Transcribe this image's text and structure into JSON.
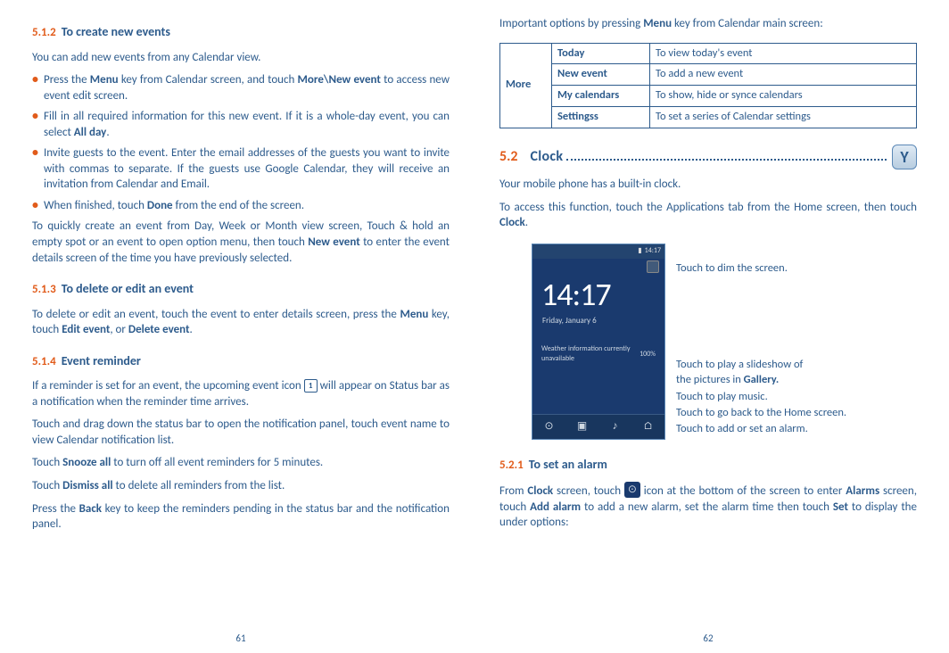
{
  "left": {
    "s512_num": "5.1.2",
    "s512_title": "To create new events",
    "s512_intro": "You can add new events from any Calendar view.",
    "b1_a": "Press the ",
    "b1_b": "Menu",
    "b1_c": " key from Calendar screen, and touch ",
    "b1_d": "More\\New event",
    "b1_e": " to access new event edit screen.",
    "b2_a": "Fill in all required information for this new event. If it is a whole-day event, you can select ",
    "b2_b": "All day",
    "b2_c": ".",
    "b3": "Invite guests to the event. Enter the email addresses of the guests you want to invite with commas to separate. If the guests use Google Calendar, they will receive an invitation from Calendar and Email.",
    "b4_a": "When finished, touch ",
    "b4_b": "Done",
    "b4_c": " from the end of the screen.",
    "quick_a": "To quickly create an event from Day, Week or Month view screen, Touch & hold an empty spot or an event to open option menu, then touch ",
    "quick_b": "New event",
    "quick_c": " to enter the event details screen of the time you have previously selected.",
    "s513_num": "5.1.3",
    "s513_title": "To delete or edit an event",
    "s513_a": "To delete or edit an event, touch the event to enter details screen, press the ",
    "s513_b": "Menu",
    "s513_c": " key, touch ",
    "s513_d": "Edit event",
    "s513_e": ", or ",
    "s513_f": "Delete event",
    "s513_g": ".",
    "s514_num": "5.1.4",
    "s514_title": "Event reminder",
    "s514_p1_a": "If a reminder is set for an event, the upcoming event icon ",
    "s514_p1_b": " will appear on Status bar as a notification when the reminder time arrives.",
    "s514_icon_inner": "1",
    "s514_p2": "Touch and drag down the status bar to open the notification panel, touch event name to view Calendar notification list.",
    "s514_p3_a": "Touch ",
    "s514_p3_b": "Snooze all",
    "s514_p3_c": " to turn off all event reminders for 5 minutes.",
    "s514_p4_a": "Touch ",
    "s514_p4_b": "Dismiss all",
    "s514_p4_c": " to delete all reminders from the list.",
    "s514_p5_a": "Press the ",
    "s514_p5_b": "Back",
    "s514_p5_c": " key to keep the reminders pending in the status bar and the notification panel.",
    "page_num": "61"
  },
  "right": {
    "intro_a": "Important options by pressing ",
    "intro_b": "Menu",
    "intro_c": " key from Calendar main screen:",
    "more": "More",
    "r1a": "Today",
    "r1b": "To view today's event",
    "r2a": "New event",
    "r2b": "To add a new event",
    "r3a": "My calendars",
    "r3b": "To show, hide or synce calendars",
    "r4a": "Settingss",
    "r4b": "To set a series of Calendar settings",
    "sec_num": "5.2",
    "sec_title": "Clock",
    "clock_sym": "Y",
    "p1": "Your mobile phone has a built-in clock.",
    "p2_a": "To access this function, touch the Applications tab from the Home screen, then touch ",
    "p2_b": "Clock",
    "p2_c": ".",
    "phone_time": "14:17",
    "phone_date": "Friday, January 6",
    "phone_weather_a": "Weather information currently",
    "phone_weather_b": "unavailable",
    "phone_pct": "100%",
    "phone_status_time": "14:17",
    "c1": "Touch to dim the screen.",
    "c2a": "Touch to play a slideshow of",
    "c2b": "the pictures in ",
    "c2c": "Gallery.",
    "c3": "Touch to play music.",
    "c4": "Touch to go back to the Home screen.",
    "c5": "Touch to add or set an alarm.",
    "s521_num": "5.2.1",
    "s521_title": "To set an alarm",
    "s521_a": "From ",
    "s521_b": "Clock",
    "s521_c": " screen, touch ",
    "s521_d": " icon at the bottom of the screen to enter ",
    "s521_e": "Alarms",
    "s521_f": " screen, touch ",
    "s521_g": "Add alarm",
    "s521_h": " to add a new alarm, set the alarm time then touch ",
    "s521_i": "Set",
    "s521_j": " to display the under options:",
    "alarm_sym": "⊙",
    "page_num": "62"
  }
}
